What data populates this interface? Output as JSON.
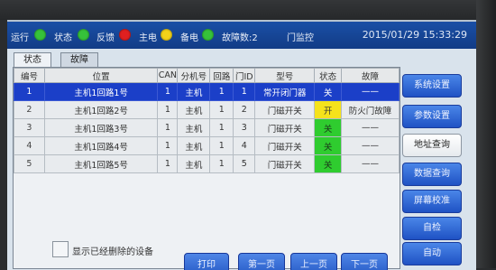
{
  "statusbar": {
    "run_label": "运行",
    "status_label": "状态",
    "feedback_label": "反馈",
    "main_label": "主电",
    "backup_label": "备电",
    "fault_count_label": "故障数:2",
    "title": "门监控",
    "clock": "2015/01/29 15:33:29",
    "colors": {
      "green": "#36c23a",
      "red": "#e02020",
      "yellow": "#f2d21a"
    }
  },
  "tabs": [
    {
      "label": "状态"
    },
    {
      "label": "故障"
    }
  ],
  "table": {
    "headers": [
      "编号",
      "位置",
      "CAN",
      "分机号",
      "回路",
      "门ID",
      "型号",
      "状态",
      "故障"
    ],
    "rows": [
      {
        "no": "1",
        "location": "主机1回路1号",
        "can": "1",
        "ext": "主机",
        "loop": "1",
        "door_id": "1",
        "model": "常开闭门器",
        "state": "关",
        "fault": "——",
        "selected": true
      },
      {
        "no": "2",
        "location": "主机1回路2号",
        "can": "1",
        "ext": "主机",
        "loop": "1",
        "door_id": "2",
        "model": "门磁开关",
        "state": "开",
        "fault": "防火门故障"
      },
      {
        "no": "3",
        "location": "主机1回路3号",
        "can": "1",
        "ext": "主机",
        "loop": "1",
        "door_id": "3",
        "model": "门磁开关",
        "state": "关",
        "fault": "——"
      },
      {
        "no": "4",
        "location": "主机1回路4号",
        "can": "1",
        "ext": "主机",
        "loop": "1",
        "door_id": "4",
        "model": "门磁开关",
        "state": "关",
        "fault": "——"
      },
      {
        "no": "5",
        "location": "主机1回路5号",
        "can": "1",
        "ext": "主机",
        "loop": "1",
        "door_id": "5",
        "model": "门磁开关",
        "state": "关",
        "fault": "——"
      }
    ]
  },
  "checkbox_label": "显示已经删除的设备",
  "bottom_buttons": [
    "打印",
    "第一页",
    "上一页",
    "下一页"
  ],
  "side_buttons": [
    "系统设置",
    "参数设置",
    "地址查询",
    "数据查询",
    "屏幕校准",
    "自检",
    "自动"
  ]
}
